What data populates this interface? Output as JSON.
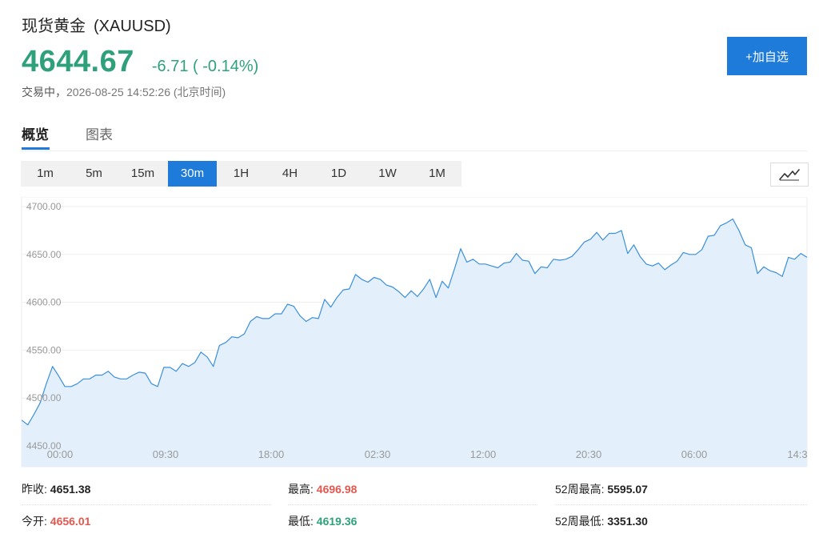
{
  "header": {
    "name": "现货黄金",
    "symbol": "(XAUUSD)",
    "price": "4644.67",
    "change": "-6.71 ( -0.14%)",
    "status_label": "交易中，",
    "timestamp": "2026-08-25 14:52:26 (北京时间)",
    "add_button": "+加自选"
  },
  "tabs": [
    {
      "label": "概览",
      "active": true
    },
    {
      "label": "图表",
      "active": false
    }
  ],
  "intervals": [
    {
      "label": "1m",
      "active": false
    },
    {
      "label": "5m",
      "active": false
    },
    {
      "label": "15m",
      "active": false
    },
    {
      "label": "30m",
      "active": true
    },
    {
      "label": "1H",
      "active": false
    },
    {
      "label": "4H",
      "active": false
    },
    {
      "label": "1D",
      "active": false
    },
    {
      "label": "1W",
      "active": false
    },
    {
      "label": "1M",
      "active": false
    }
  ],
  "chart_type_icon": "line-chart-icon",
  "colors": {
    "accent": "#1e7bd9",
    "up": "#e4574f",
    "down": "#2fa17a",
    "line": "#3b8fdc",
    "fill": "#e3f0fc"
  },
  "chart_data": {
    "type": "area",
    "ylim": [
      4450,
      4700
    ],
    "yticks": [
      "4700.00",
      "4650.00",
      "4600.00",
      "4550.00",
      "4500.00",
      "4450.00"
    ],
    "ytick_values": [
      4700,
      4650,
      4600,
      4550,
      4500,
      4450
    ],
    "xticks": [
      "00:00",
      "09:30",
      "18:00",
      "02:30",
      "12:00",
      "20:30",
      "06:00",
      "14:3"
    ],
    "grid": true,
    "values": [
      4477,
      4472,
      4483,
      4495,
      4515,
      4533,
      4523,
      4512,
      4512,
      4515,
      4520,
      4520,
      4524,
      4524,
      4528,
      4522,
      4520,
      4520,
      4524,
      4527,
      4526,
      4515,
      4512,
      4532,
      4532,
      4528,
      4536,
      4533,
      4537,
      4548,
      4543,
      4533,
      4555,
      4558,
      4564,
      4563,
      4567,
      4580,
      4585,
      4583,
      4583,
      4588,
      4588,
      4598,
      4596,
      4586,
      4580,
      4584,
      4583,
      4603,
      4595,
      4605,
      4613,
      4614,
      4629,
      4624,
      4621,
      4626,
      4624,
      4618,
      4616,
      4611,
      4605,
      4612,
      4606,
      4614,
      4624,
      4605,
      4622,
      4615,
      4635,
      4656,
      4642,
      4645,
      4640,
      4640,
      4638,
      4636,
      4641,
      4642,
      4651,
      4644,
      4643,
      4630,
      4637,
      4636,
      4645,
      4644,
      4645,
      4648,
      4655,
      4663,
      4666,
      4673,
      4665,
      4672,
      4672,
      4675,
      4651,
      4660,
      4648,
      4640,
      4638,
      4641,
      4634,
      4639,
      4643,
      4652,
      4650,
      4650,
      4655,
      4669,
      4670,
      4680,
      4683,
      4687,
      4675,
      4660,
      4657,
      4630,
      4637,
      4633,
      4631,
      4627,
      4647,
      4645,
      4651,
      4647
    ]
  },
  "stats": [
    {
      "label": "昨收:",
      "value": "4651.38",
      "tone": "neutral"
    },
    {
      "label": "最高:",
      "value": "4696.98",
      "tone": "red"
    },
    {
      "label": "52周最高:",
      "value": "5595.07",
      "tone": "neutral"
    },
    {
      "label": "今开:",
      "value": "4656.01",
      "tone": "red"
    },
    {
      "label": "最低:",
      "value": "4619.36",
      "tone": "green"
    },
    {
      "label": "52周最低:",
      "value": "3351.30",
      "tone": "neutral"
    }
  ]
}
